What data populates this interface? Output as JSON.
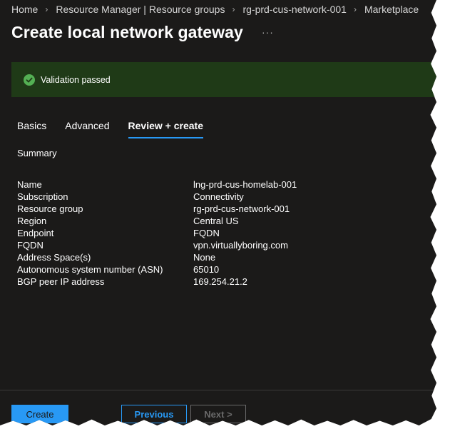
{
  "breadcrumb": [
    {
      "label": "Home"
    },
    {
      "label": "Resource Manager | Resource groups"
    },
    {
      "label": "rg-prd-cus-network-001"
    },
    {
      "label": "Marketplace"
    }
  ],
  "page": {
    "title": "Create local network gateway",
    "more_label": "···"
  },
  "validation": {
    "message": "Validation passed",
    "status_color": "#54b054",
    "icon": "checkmark-circle-icon"
  },
  "tabs": [
    {
      "label": "Basics",
      "active": false
    },
    {
      "label": "Advanced",
      "active": false
    },
    {
      "label": "Review + create",
      "active": true
    }
  ],
  "summary": {
    "heading": "Summary",
    "rows": [
      {
        "label": "Name",
        "value": "lng-prd-cus-homelab-001"
      },
      {
        "label": "Subscription",
        "value": "Connectivity"
      },
      {
        "label": "Resource group",
        "value": "rg-prd-cus-network-001"
      },
      {
        "label": "Region",
        "value": "Central US"
      },
      {
        "label": "Endpoint",
        "value": "FQDN"
      },
      {
        "label": "FQDN",
        "value": "vpn.virtuallyboring.com"
      },
      {
        "label": "Address Space(s)",
        "value": "None"
      },
      {
        "label": "Autonomous system number (ASN)",
        "value": "65010"
      },
      {
        "label": "BGP peer IP address",
        "value": "169.254.21.2"
      }
    ]
  },
  "footer": {
    "create_label": "Create",
    "previous_label": "Previous",
    "next_label": "Next >"
  },
  "colors": {
    "accent": "#2899f5",
    "background": "#1b1a19",
    "validation_bg": "#1f3a17"
  }
}
